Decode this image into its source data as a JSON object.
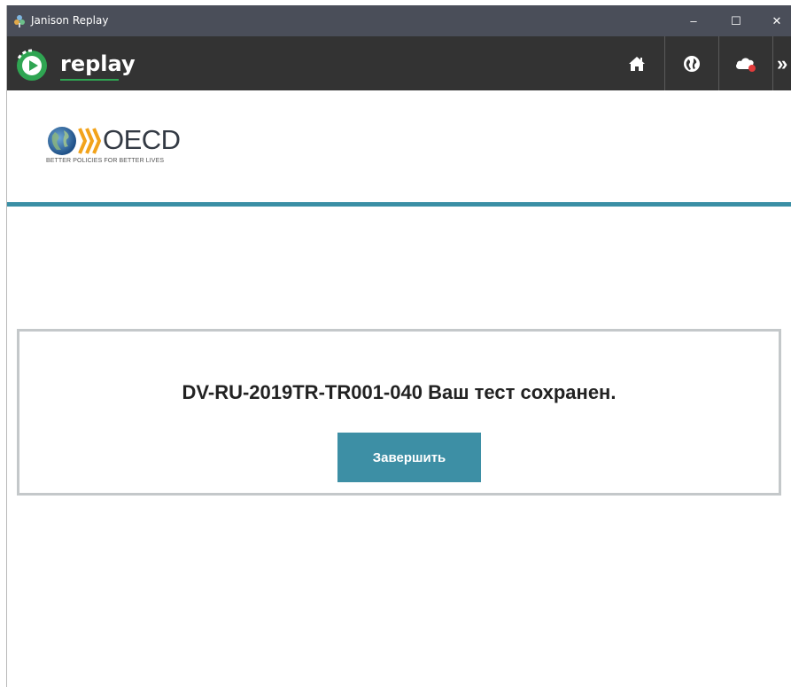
{
  "window": {
    "title": "Janison Replay",
    "controls": {
      "minimize": "–",
      "maximize": "☐",
      "close": "✕"
    }
  },
  "appbar": {
    "brand": "replay",
    "more_label": "»",
    "icons": [
      "home-icon",
      "globe-icon",
      "cloud-icon"
    ]
  },
  "logo": {
    "name": "OECD",
    "tagline": "BETTER POLICIES FOR BETTER LIVES"
  },
  "dialog": {
    "message": "DV-RU-2019TR-TR001-040 Ваш тест сохранен.",
    "button_label": "Завершить"
  },
  "colors": {
    "titlebar": "#4a4e59",
    "appbar": "#333333",
    "accent": "#3a8fa5",
    "brand_green": "#2fa552",
    "cloud_alert": "#e23b3b"
  }
}
